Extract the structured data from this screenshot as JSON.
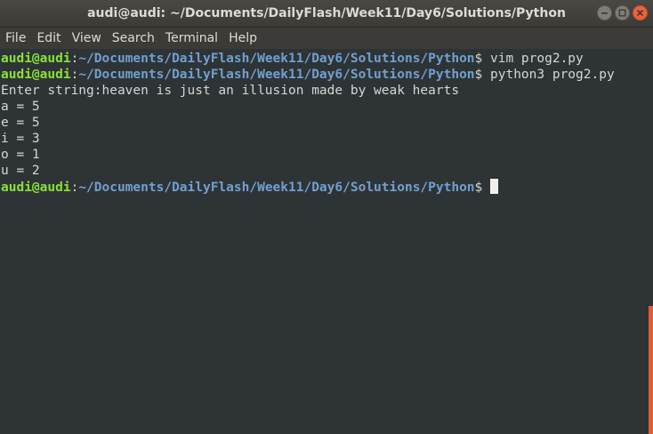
{
  "window": {
    "title": "audi@audi: ~/Documents/DailyFlash/Week11/Day6/Solutions/Python"
  },
  "menu": {
    "items": [
      "File",
      "Edit",
      "View",
      "Search",
      "Terminal",
      "Help"
    ]
  },
  "terminal": {
    "prompt_user": "audi@audi",
    "prompt_sep": ":",
    "prompt_path": "~/Documents/DailyFlash/Week11/Day6/Solutions/Python",
    "prompt_symbol": "$ ",
    "lines": [
      {
        "type": "prompt",
        "command": "vim prog2.py"
      },
      {
        "type": "prompt",
        "command": "python3 prog2.py"
      },
      {
        "type": "output",
        "text": "Enter string:heaven is just an illusion made by weak hearts"
      },
      {
        "type": "output",
        "text": "a = 5"
      },
      {
        "type": "output",
        "text": "e = 5"
      },
      {
        "type": "output",
        "text": "i = 3"
      },
      {
        "type": "output",
        "text": "o = 1"
      },
      {
        "type": "output",
        "text": "u = 2"
      },
      {
        "type": "prompt",
        "command": "",
        "cursor": true
      }
    ]
  },
  "colors": {
    "background": "#2e3436",
    "prompt_user": "#8ae234",
    "prompt_path": "#729fcf",
    "text": "#d3d7cf",
    "scrollbar": "#e05d33",
    "close_button": "#e9643c"
  }
}
